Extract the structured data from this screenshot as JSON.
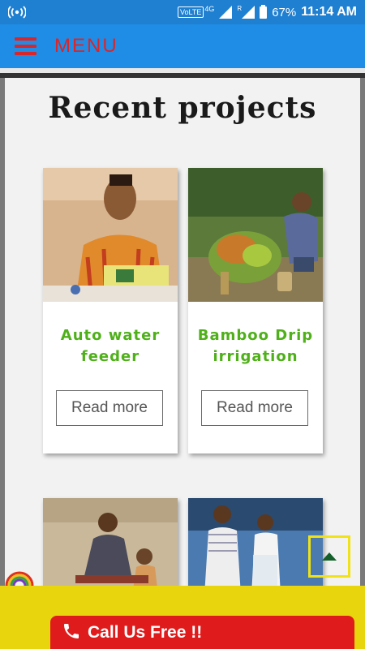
{
  "status_bar": {
    "volte": "VoLTE",
    "network": "4G",
    "roaming": "R",
    "battery": "67%",
    "time": "11:14 AM"
  },
  "nav": {
    "menu_label": "MENU"
  },
  "section": {
    "heading": "Recent projects"
  },
  "projects": [
    {
      "title_line1": "Auto water",
      "title_line2": "feeder",
      "button": "Read more"
    },
    {
      "title_line1": "Bamboo Drip",
      "title_line2": "irrigation",
      "button": "Read more"
    }
  ],
  "footer": {
    "call_label": "Call Us Free !!"
  },
  "colors": {
    "status_bar": "#1f7fd0",
    "nav_bar": "#1f8de6",
    "menu_red": "#d9262a",
    "title_green": "#4fb01a",
    "footer_yellow": "#e8d50e",
    "call_red": "#e01b1b"
  },
  "icons": [
    "hotspot-icon",
    "signal-icon",
    "battery-icon",
    "hamburger-icon",
    "phone-icon",
    "arrow-up-icon"
  ]
}
